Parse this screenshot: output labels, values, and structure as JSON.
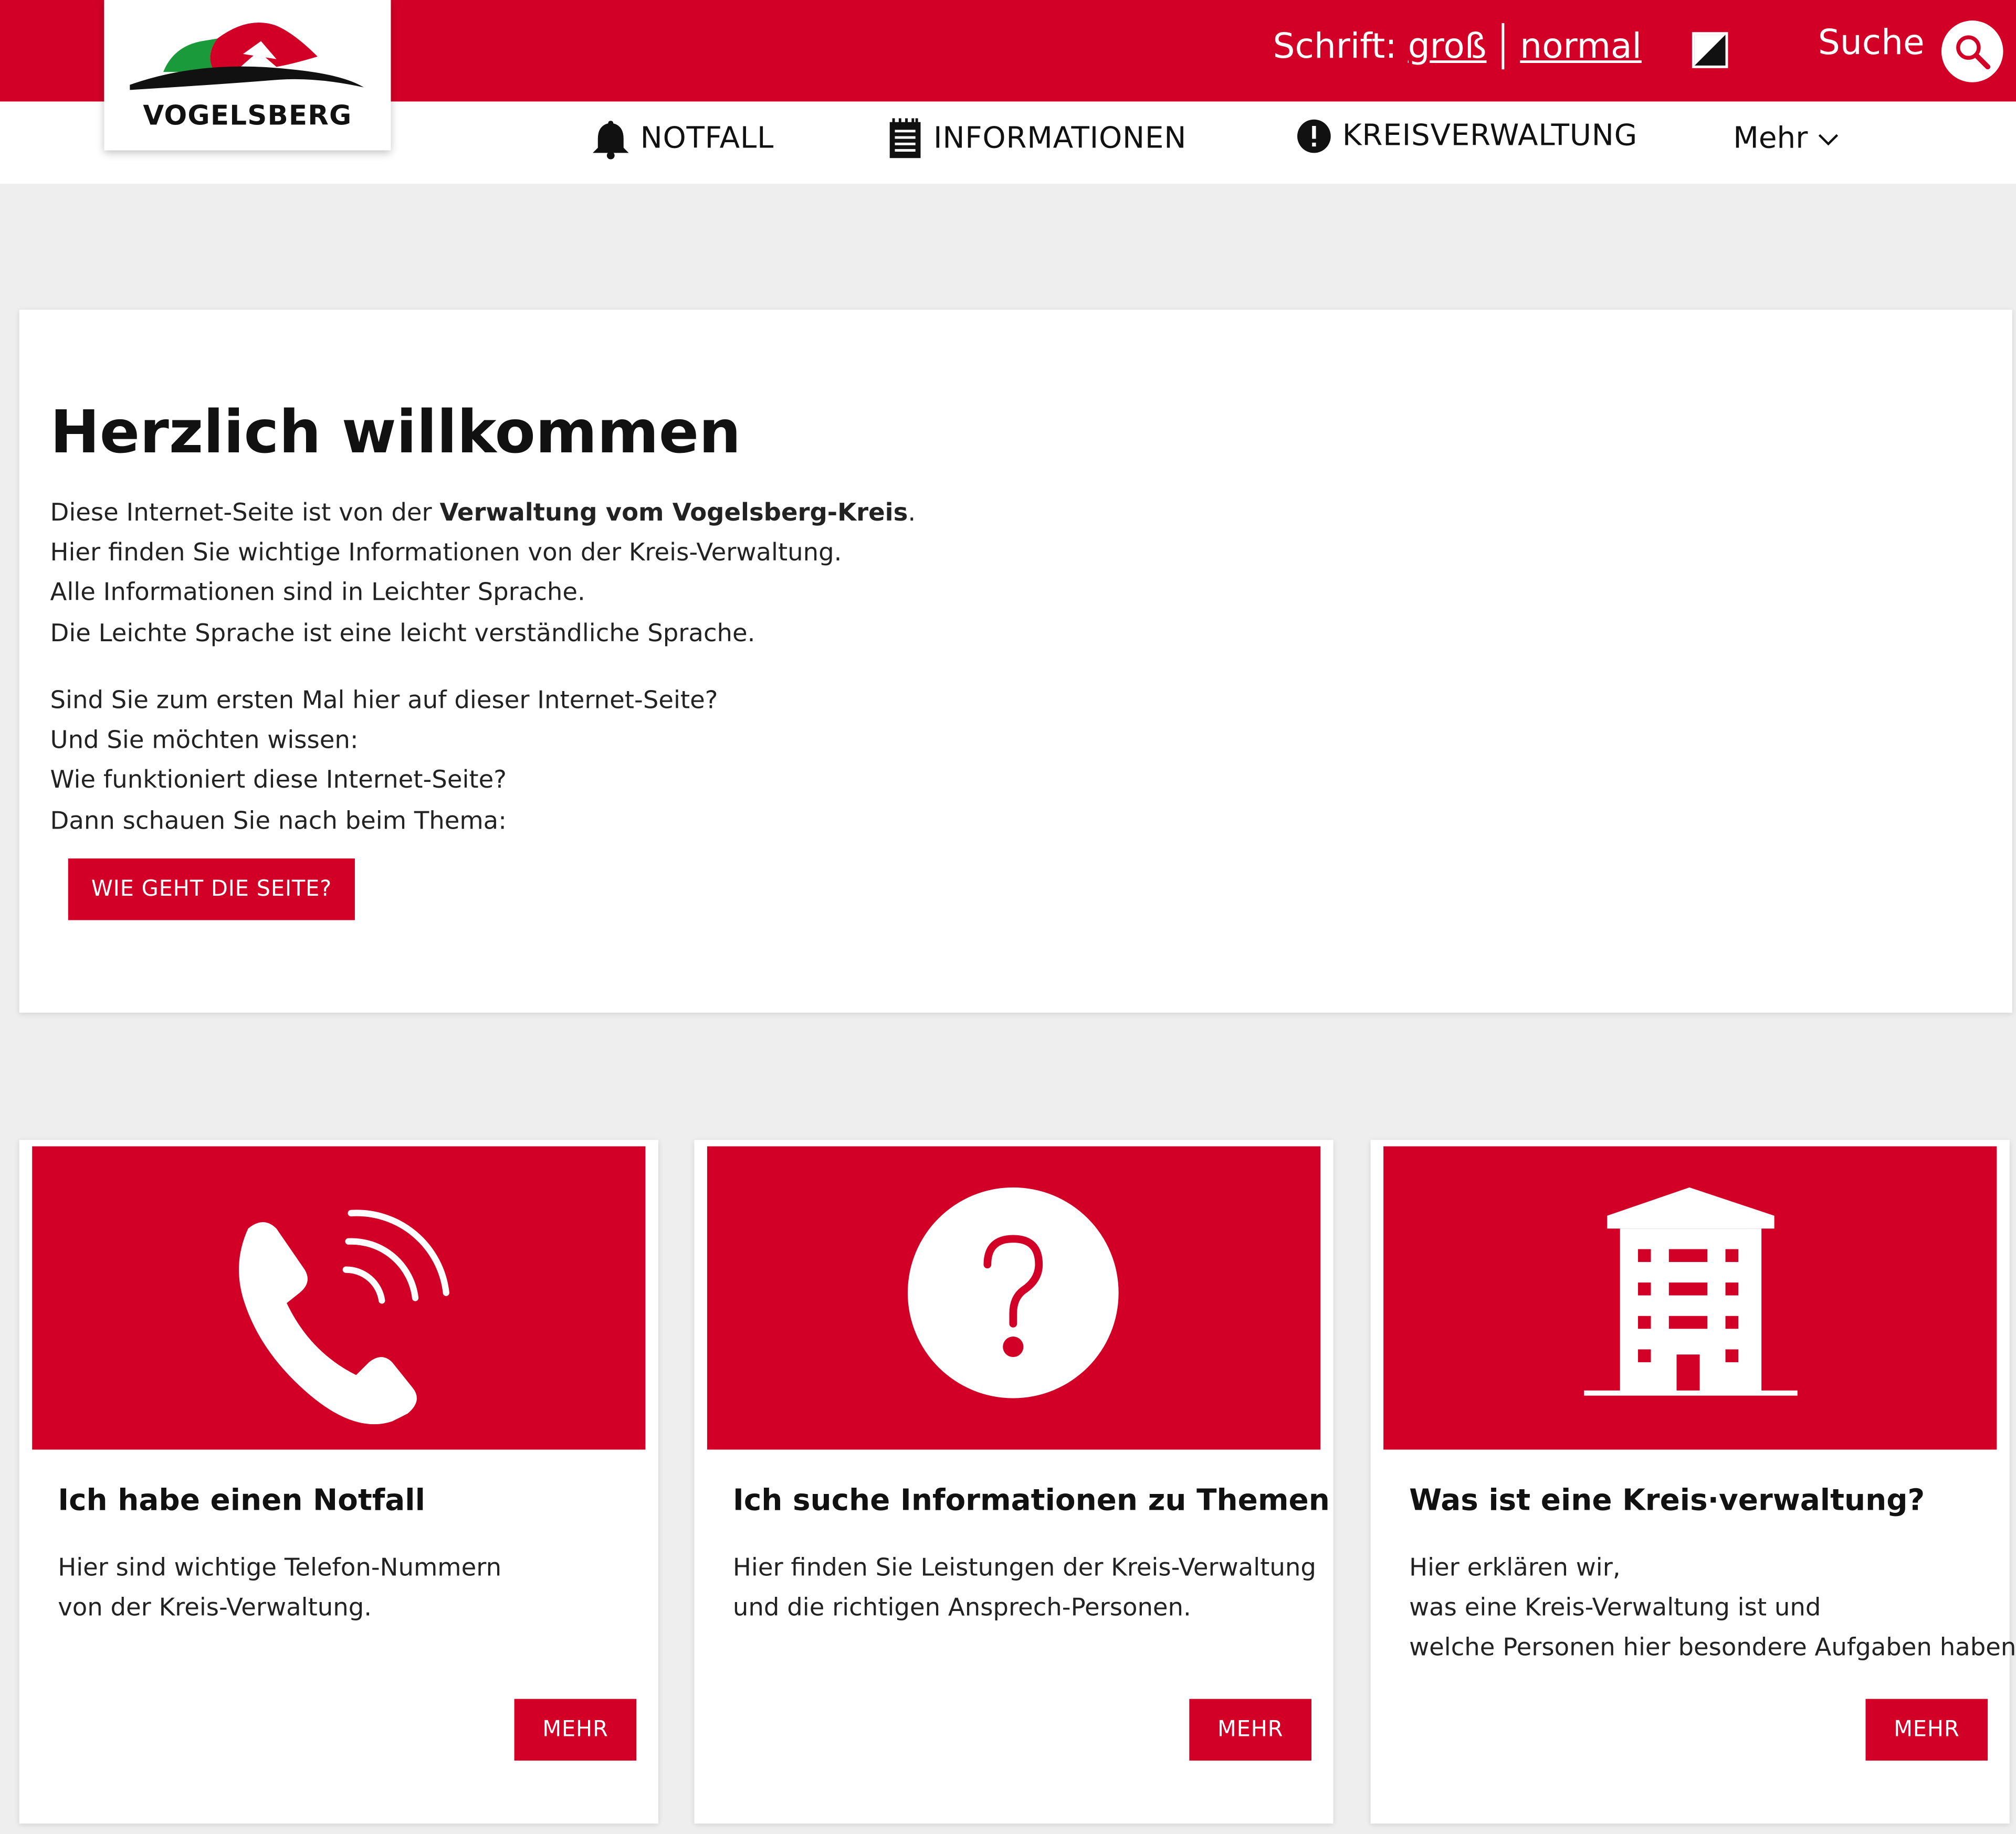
{
  "header": {
    "logo_text": "VOGELSBERG",
    "font_label": "Schrift:",
    "font_large": "groß",
    "font_normal": "normal",
    "search_label": "Suche"
  },
  "nav": {
    "items": [
      {
        "label": "NOTFALL",
        "icon": "bell-icon"
      },
      {
        "label": "INFORMATIONEN",
        "icon": "notepad-icon"
      },
      {
        "label": "KREISVERWALTUNG",
        "icon": "info-exclamation-icon"
      }
    ],
    "more_label": "Mehr"
  },
  "welcome": {
    "title": "Herzlich willkommen",
    "line1_prefix": "Diese Internet-Seite ist von der ",
    "line1_bold": "Verwaltung vom Vogelsberg-Kreis",
    "line1_suffix": ".",
    "line2": "Hier finden Sie wichtige Informationen von der Kreis-Verwaltung.",
    "line3": "Alle Informationen sind in Leichter Sprache.",
    "line4": "Die Leichte Sprache ist eine leicht verständliche Sprache.",
    "line5": "Sind Sie zum ersten Mal hier auf dieser Internet-Seite?",
    "line6": "Und Sie möchten wissen:",
    "line7": "Wie funktioniert diese Internet-Seite?",
    "line8": "Dann schauen Sie nach beim Thema:",
    "button_label": "WIE GEHT DIE SEITE?"
  },
  "cards": [
    {
      "icon": "phone-icon",
      "title": "Ich habe einen Notfall",
      "lines": [
        "Hier sind wichtige Telefon-Nummern",
        "von der Kreis-Verwaltung."
      ],
      "button": "MEHR"
    },
    {
      "icon": "question-icon",
      "title": "Ich suche Informationen zu Themen",
      "lines": [
        "Hier finden Sie Leistungen der Kreis-Verwaltung",
        "und die richtigen Ansprech-Personen."
      ],
      "button": "MEHR"
    },
    {
      "icon": "building-icon",
      "title": "Was ist eine Kreis·verwaltung?",
      "lines": [
        "Hier erklären wir,",
        "was eine Kreis-Verwaltung ist und",
        "welche Personen hier besondere Aufgaben haben."
      ],
      "button": "MEHR"
    }
  ],
  "colors": {
    "brand_red": "#d20027",
    "page_bg": "#eeeeee"
  }
}
